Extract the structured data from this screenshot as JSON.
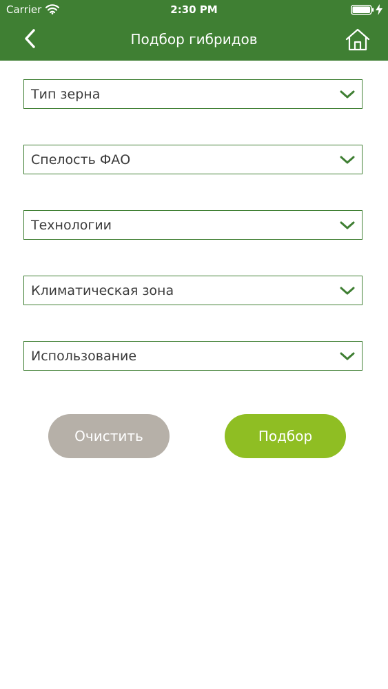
{
  "status_bar": {
    "carrier": "Carrier",
    "time": "2:30 PM"
  },
  "header": {
    "title": "Подбор гибридов",
    "back_icon": "back-arrow-icon",
    "home_icon": "home-icon"
  },
  "filters": [
    {
      "label": "Тип зерна"
    },
    {
      "label": "Спелость ФАО"
    },
    {
      "label": "Технологии"
    },
    {
      "label": "Климатическая зона"
    },
    {
      "label": "Использование"
    }
  ],
  "actions": {
    "clear_label": "Очистить",
    "submit_label": "Подбор"
  },
  "colors": {
    "header": "#3f7f33",
    "clear_button": "#b6b0a8",
    "submit_button": "#8fbe23",
    "accent": "#3f7f33"
  }
}
